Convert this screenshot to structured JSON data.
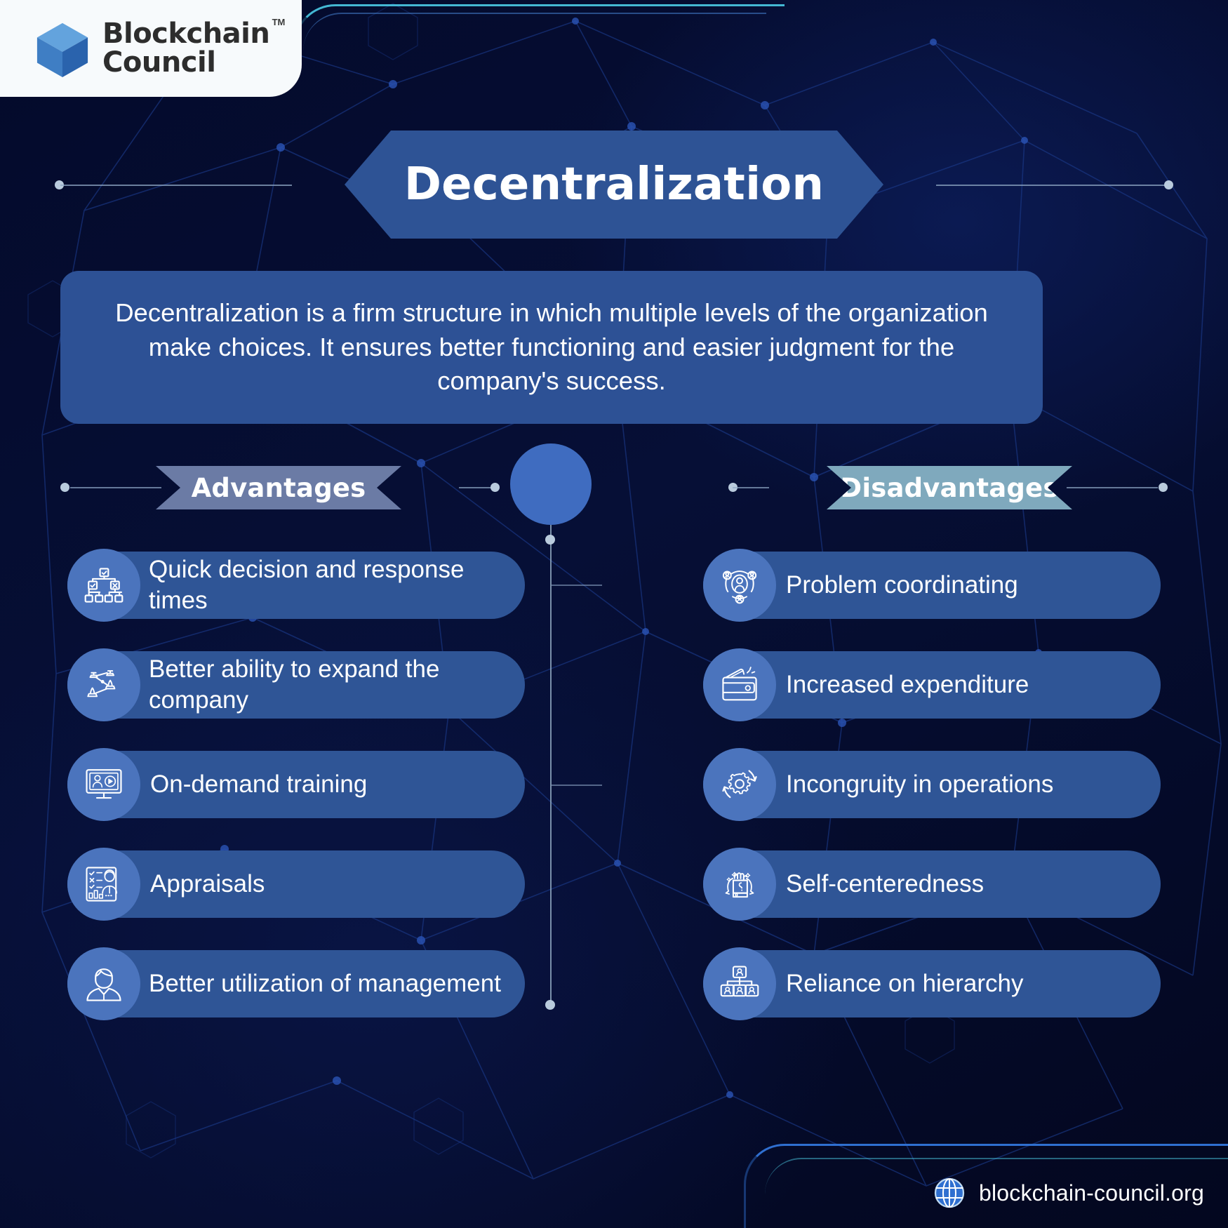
{
  "brand": {
    "name_line1": "Blockchain",
    "name_line2": "Council",
    "trademark": "TM",
    "logo_icon": "cube-icon",
    "colors": {
      "cube_light": "#5b9bd5",
      "cube_mid": "#3f7ec4",
      "cube_dark": "#2e66ae"
    }
  },
  "header": {
    "title": "Decentralization"
  },
  "description": {
    "text": "Decentralization is a firm structure in which multiple levels of the organization make choices. It ensures better functioning and easier judgment for the company's success.",
    "line1": "Decentralization is a firm structure in which multiple levels of the",
    "line2": "organization make choices. It ensures better functioning",
    "line3": "and easier judgment for the company's success."
  },
  "sections": {
    "advantages": {
      "label": "Advantages",
      "color": "#6b7ba5",
      "items": [
        {
          "label": "Quick decision and response times",
          "icon": "decision-tree-icon"
        },
        {
          "label": "Better ability to expand the company",
          "icon": "network-expand-icon"
        },
        {
          "label": "On-demand training",
          "icon": "monitor-training-icon"
        },
        {
          "label": "Appraisals",
          "icon": "checklist-person-icon"
        },
        {
          "label": "Better utilization of management",
          "icon": "manager-person-icon"
        }
      ]
    },
    "disadvantages": {
      "label": "Disadvantages",
      "color": "#7fa9bd",
      "items": [
        {
          "label": "Problem coordinating",
          "icon": "people-network-icon"
        },
        {
          "label": "Increased expenditure",
          "icon": "wallet-icon"
        },
        {
          "label": "Incongruity in operations",
          "icon": "gear-cycle-icon"
        },
        {
          "label": "Self-centeredness",
          "icon": "raised-fist-icon"
        },
        {
          "label": "Reliance on hierarchy",
          "icon": "hierarchy-icon"
        }
      ]
    }
  },
  "footer": {
    "url": "blockchain-council.org",
    "icon": "globe-icon"
  },
  "theme": {
    "background_dark": "#050a2a",
    "panel_blue": "#2d5195",
    "item_blue": "#2f5596",
    "badge_blue": "#4b74bd",
    "accent_cyan": "#4fd6f0",
    "rule_gray": "#8fa7c4"
  }
}
